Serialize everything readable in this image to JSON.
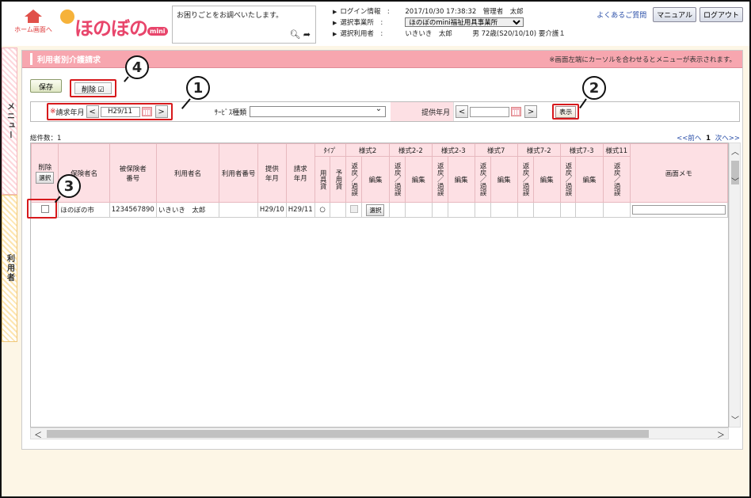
{
  "header": {
    "home_label": "ホーム画面へ",
    "logo_text": "ほのぼの",
    "logo_mini": "mini",
    "help_placeholder": "お困りごとをお調べいたします。",
    "login_label": "ログイン情報",
    "login_value": "2017/10/30 17:38:32　管理者　太郎",
    "office_label": "選択事業所",
    "office_value": "ほのぼのmini福祉用具事業所",
    "user_label": "選択利用者",
    "user_value": "いきいき　太郎　　　男 72歳(S20/10/10) 要介護１",
    "colon": ":",
    "faq": "よくあるご質問",
    "manual": "マニュアル",
    "logout": "ログアウト"
  },
  "side_tabs": {
    "menu": "メニュー",
    "user": "利用者"
  },
  "page": {
    "title": "利用者別介護請求",
    "note": "※画面左端にカーソルを合わせるとメニューが表示されます。",
    "save": "保存",
    "delete": "削除",
    "delete_check": "☑"
  },
  "filters": {
    "req_mark": "※",
    "claim_month_label": "請求年月",
    "claim_month_value": "H29/11",
    "service_type_label": "ｻｰﾋﾞｽ種類",
    "service_type_value": "",
    "provide_month_label": "提供年月",
    "provide_month_value": "",
    "show": "表示",
    "prev": "<",
    "next": ">"
  },
  "list": {
    "count_label": "総件数：1",
    "pager_prev": "<<前へ",
    "pager_page": "1",
    "pager_next": "次へ>>"
  },
  "table": {
    "headers": {
      "delete": "削除",
      "select_all": "選択",
      "insurer": "保険者名",
      "insured_no": "被保険者\n番号",
      "user_name": "利用者名",
      "user_no": "利用者番号",
      "provide_ym": "提供\n年月",
      "claim_ym": "請求\n年月",
      "type_group": "ﾀｲﾌﾟ",
      "type_rental": "用具貸",
      "type_preventive": "予用貸",
      "forms": [
        "様式2",
        "様式2-2",
        "様式2-3",
        "様式7",
        "様式7-2",
        "様式7-3",
        "様式11"
      ],
      "return_err": "返戻／過誤",
      "edit": "編集",
      "memo": "画面メモ"
    },
    "rows": [
      {
        "insurer": "ほのぼの市",
        "insured_no": "1234567890",
        "user_name": "いきいき　太郎",
        "user_no": "",
        "provide_ym": "H29/10",
        "claim_ym": "H29/11",
        "type_rental": "○",
        "select_btn": "選択"
      }
    ]
  },
  "callouts": [
    "①",
    "②",
    "③",
    "④"
  ],
  "callout_numbers": [
    "1",
    "2",
    "3",
    "4"
  ]
}
